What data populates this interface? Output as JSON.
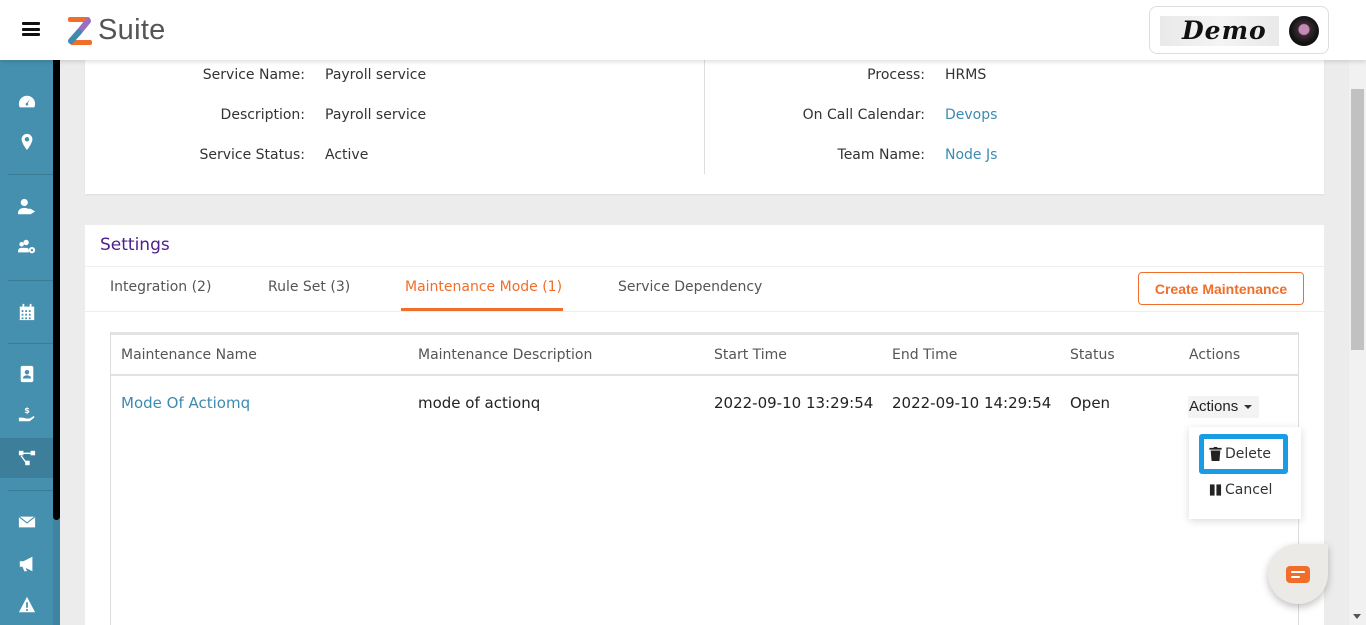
{
  "header": {
    "brand": "Suite",
    "profile_name": "Demo"
  },
  "sidebar": {
    "items": [
      {
        "icon": "dashboard-gauge-icon",
        "active": false
      },
      {
        "icon": "location-pin-icon",
        "active": false
      },
      {
        "icon": "user-tag-icon",
        "active": false
      },
      {
        "icon": "users-cog-icon",
        "active": false
      },
      {
        "icon": "calendar-icon",
        "active": false
      },
      {
        "icon": "contact-book-icon",
        "active": false
      },
      {
        "icon": "hand-dollar-icon",
        "active": false
      },
      {
        "icon": "sitemap-icon",
        "active": true
      },
      {
        "icon": "envelope-icon",
        "active": false
      },
      {
        "icon": "megaphone-icon",
        "active": false
      },
      {
        "icon": "warning-icon",
        "active": false
      }
    ]
  },
  "service_info": {
    "left": [
      {
        "label": "Service Name:",
        "value": "Payroll service"
      },
      {
        "label": "Description:",
        "value": "Payroll service"
      },
      {
        "label": "Service Status:",
        "value": "Active"
      }
    ],
    "right": [
      {
        "label": "Process:",
        "value": "HRMS"
      },
      {
        "label": "On Call Calendar:",
        "value": "Devops"
      },
      {
        "label": "Team Name:",
        "value": "Node Js"
      }
    ]
  },
  "settings": {
    "title": "Settings",
    "tabs": [
      {
        "label": "Integration (2)",
        "active": false
      },
      {
        "label": "Rule Set (3)",
        "active": false
      },
      {
        "label": "Maintenance Mode (1)",
        "active": true
      },
      {
        "label": "Service Dependency",
        "active": false
      }
    ],
    "create_button": "Create Maintenance",
    "table": {
      "columns": [
        "Maintenance Name",
        "Maintenance Description",
        "Start Time",
        "End Time",
        "Status",
        "Actions"
      ],
      "rows": [
        {
          "name": "Mode Of Actiomq",
          "description": "mode of actionq",
          "start_time": "2022-09-10 13:29:54",
          "end_time": "2022-09-10 14:29:54",
          "status": "Open",
          "actions_label": "Actions"
        }
      ]
    },
    "actions_menu": {
      "items": [
        {
          "label": "Delete",
          "icon": "trash-icon",
          "focused": true
        },
        {
          "label": "Cancel",
          "icon": "pause-icon",
          "focused": false
        }
      ]
    }
  },
  "colors": {
    "sidebar": "#4690af",
    "accent": "#f06e2a",
    "link": "#3e8ab0",
    "title": "#4b1f8c",
    "focus_ring": "#1a9be6"
  }
}
